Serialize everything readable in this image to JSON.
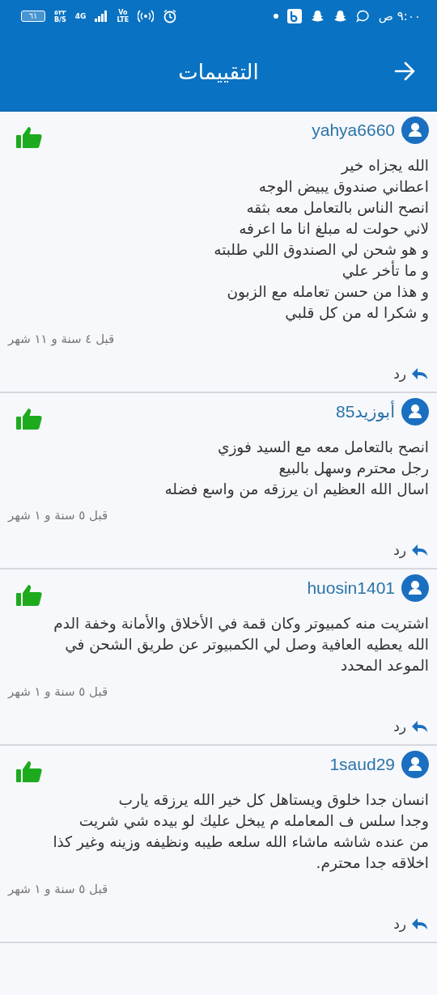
{
  "status_bar": {
    "time": "٩:٠٠ ص",
    "battery": "٦١",
    "speed_value": "٥٢٢",
    "speed_unit": "B/S",
    "network": "4G",
    "volte_top": "Vo",
    "volte_bottom": "LTE"
  },
  "header": {
    "title": "التقييمات"
  },
  "reviews": [
    {
      "user": "yahya6660",
      "liked": true,
      "text": "الله يجزاه خير\nاعطاني صندوق يبيض الوجه\nانصح الناس بالتعامل معه بثقه\nلاني حولت له مبلغ انا ما اعرفه\nو هو شحن لي الصندوق اللي طلبته\nو ما تأخر علي\nو هذا من حسن تعامله مع الزبون\nو شكرا له من كل قلبي",
      "time": "قبل ٤ سنة و ١١ شهر",
      "reply": "رد"
    },
    {
      "user": "أبوزيد85",
      "liked": true,
      "text": "انصح بالتعامل معه مع السيد فوزي\nرجل محترم وسهل بالبيع\nاسال الله العظيم ان يرزقه من واسع فضله",
      "time": "قبل ٥ سنة و ١ شهر",
      "reply": "رد"
    },
    {
      "user": "huosin1401",
      "liked": true,
      "text": "اشتريت منه كمبيوتر وكان قمة في الأخلاق والأمانة وخفة الدم\nالله يعطيه العافية وصل لي الكمبيوتر عن طريق الشحن  في\nالموعد المحدد",
      "time": "قبل ٥ سنة و ١ شهر",
      "reply": "رد"
    },
    {
      "user": "1saud29",
      "liked": true,
      "text": "انسان جدا  خلوق ويستاهل كل خير الله يرزقه يارب\nوجدا  سلس ف المعامله م يبخل عليك لو بيده شي شريت\nمن عنده شاشه ماشاء الله سلعه طيبه ونظيفه وزينه وغير كذا\nاخلاقه جدا  محترم.",
      "time": "قبل ٥ سنة و ١ شهر",
      "reply": "رد"
    }
  ]
}
